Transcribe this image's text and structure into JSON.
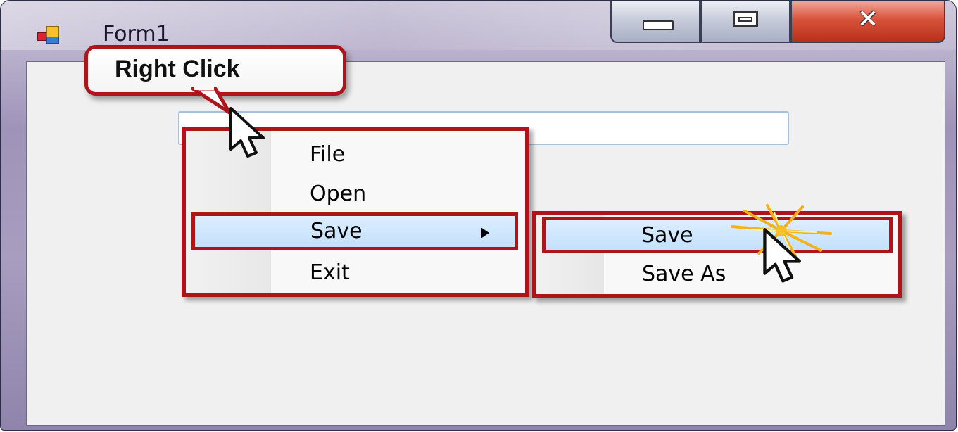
{
  "window": {
    "title": "Form1",
    "icons": {
      "app": "form-app-icon",
      "minimize": "minimize-icon",
      "maximize": "maximize-icon",
      "close": "close-icon"
    },
    "close_glyph": "✕"
  },
  "callout": {
    "text": "Right Click",
    "border_color": "#b0141b"
  },
  "context_menu": {
    "items": [
      {
        "label": "File"
      },
      {
        "label": "Open"
      },
      {
        "label": "Save",
        "has_submenu": true,
        "highlighted": true
      },
      {
        "label": "Exit"
      }
    ]
  },
  "submenu": {
    "items": [
      {
        "label": "Save",
        "highlighted": true
      },
      {
        "label": "Save As"
      }
    ]
  },
  "colors": {
    "highlight_border": "#b0141b",
    "menu_hover": "#c4e0fb"
  }
}
